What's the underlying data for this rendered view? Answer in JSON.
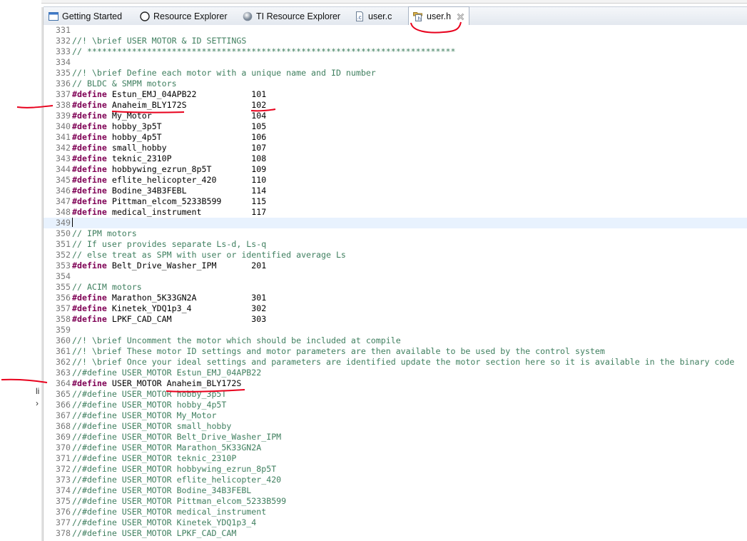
{
  "tabs": [
    {
      "label": "Getting Started",
      "icon": "window-icon",
      "active": false
    },
    {
      "label": "Resource Explorer",
      "icon": "compass-icon",
      "active": false
    },
    {
      "label": "TI Resource Explorer",
      "icon": "globe-icon",
      "active": false
    },
    {
      "label": "user.c",
      "icon": "c-file-icon",
      "active": false
    },
    {
      "label": "user.h",
      "icon": "h-file-icon",
      "active": true
    }
  ],
  "left_fragments": [
    "li",
    "›"
  ],
  "colors": {
    "keyword": "#7f0055",
    "comment": "#3f7f5f",
    "line_number": "#787878",
    "current_line": "#e8f2fe",
    "annotation": "#e8001c"
  },
  "current_line": 349,
  "lines": [
    {
      "n": "331",
      "k": "blank",
      "t": ""
    },
    {
      "n": "332",
      "k": "comment",
      "t": "//! \\brief USER MOTOR & ID SETTINGS"
    },
    {
      "n": "333",
      "k": "comment",
      "t": "// **************************************************************************"
    },
    {
      "n": "334",
      "k": "blank",
      "t": ""
    },
    {
      "n": "335",
      "k": "comment",
      "t": "//! \\brief Define each motor with a unique name and ID number"
    },
    {
      "n": "336",
      "k": "comment",
      "t": "// BLDC & SMPM motors"
    },
    {
      "n": "337",
      "k": "define",
      "t": " Estun_EMJ_04APB22           101"
    },
    {
      "n": "338",
      "k": "define",
      "t": " Anaheim_BLY172S             102"
    },
    {
      "n": "339",
      "k": "define",
      "t": " My_Motor                    104"
    },
    {
      "n": "340",
      "k": "define",
      "t": " hobby_3p5T                  105"
    },
    {
      "n": "341",
      "k": "define",
      "t": " hobby_4p5T                  106"
    },
    {
      "n": "342",
      "k": "define",
      "t": " small_hobby                 107"
    },
    {
      "n": "343",
      "k": "define",
      "t": " teknic_2310P                108"
    },
    {
      "n": "344",
      "k": "define",
      "t": " hobbywing_ezrun_8p5T        109"
    },
    {
      "n": "345",
      "k": "define",
      "t": " eflite_helicopter_420       110"
    },
    {
      "n": "346",
      "k": "define",
      "t": " Bodine_34B3FEBL             114"
    },
    {
      "n": "347",
      "k": "define",
      "t": " Pittman_elcom_5233B599      115"
    },
    {
      "n": "348",
      "k": "define",
      "t": " medical_instrument          117"
    },
    {
      "n": "349",
      "k": "blank",
      "t": ""
    },
    {
      "n": "350",
      "k": "comment",
      "t": "// IPM motors"
    },
    {
      "n": "351",
      "k": "comment",
      "t": "// If user provides separate Ls-d, Ls-q"
    },
    {
      "n": "352",
      "k": "comment",
      "t": "// else treat as SPM with user or identified average Ls"
    },
    {
      "n": "353",
      "k": "define",
      "t": " Belt_Drive_Washer_IPM       201"
    },
    {
      "n": "354",
      "k": "blank",
      "t": ""
    },
    {
      "n": "355",
      "k": "comment",
      "t": "// ACIM motors"
    },
    {
      "n": "356",
      "k": "define",
      "t": " Marathon_5K33GN2A           301"
    },
    {
      "n": "357",
      "k": "define",
      "t": " Kinetek_YDQ1p3_4            302"
    },
    {
      "n": "358",
      "k": "define",
      "t": " LPKF_CAD_CAM                303"
    },
    {
      "n": "359",
      "k": "blank",
      "t": ""
    },
    {
      "n": "360",
      "k": "comment",
      "t": "//! \\brief Uncomment the motor which should be included at compile"
    },
    {
      "n": "361",
      "k": "comment",
      "t": "//! \\brief These motor ID settings and motor parameters are then available to be used by the control system"
    },
    {
      "n": "362",
      "k": "comment",
      "t": "//! \\brief Once your ideal settings and parameters are identified update the motor section here so it is available in the binary code"
    },
    {
      "n": "363",
      "k": "comment",
      "t": "//#define USER_MOTOR Estun_EMJ_04APB22"
    },
    {
      "n": "364",
      "k": "define",
      "t": " USER_MOTOR Anaheim_BLY172S"
    },
    {
      "n": "365",
      "k": "comment",
      "t": "//#define USER_MOTOR hobby_3p5T"
    },
    {
      "n": "366",
      "k": "comment",
      "t": "//#define USER_MOTOR hobby_4p5T"
    },
    {
      "n": "367",
      "k": "comment",
      "t": "//#define USER_MOTOR My_Motor"
    },
    {
      "n": "368",
      "k": "comment",
      "t": "//#define USER_MOTOR small_hobby"
    },
    {
      "n": "369",
      "k": "comment",
      "t": "//#define USER_MOTOR Belt_Drive_Washer_IPM"
    },
    {
      "n": "370",
      "k": "comment",
      "t": "//#define USER_MOTOR Marathon_5K33GN2A"
    },
    {
      "n": "371",
      "k": "comment",
      "t": "//#define USER_MOTOR teknic_2310P"
    },
    {
      "n": "372",
      "k": "comment",
      "t": "//#define USER_MOTOR hobbywing_ezrun_8p5T"
    },
    {
      "n": "373",
      "k": "comment",
      "t": "//#define USER_MOTOR eflite_helicopter_420"
    },
    {
      "n": "374",
      "k": "comment",
      "t": "//#define USER_MOTOR Bodine_34B3FEBL"
    },
    {
      "n": "375",
      "k": "comment",
      "t": "//#define USER_MOTOR Pittman_elcom_5233B599"
    },
    {
      "n": "376",
      "k": "comment",
      "t": "//#define USER_MOTOR medical_instrument"
    },
    {
      "n": "377",
      "k": "comment",
      "t": "//#define USER_MOTOR Kinetek_YDQ1p3_4"
    },
    {
      "n": "378",
      "k": "comment",
      "t": "//#define USER_MOTOR LPKF_CAD_CAM"
    }
  ],
  "keyword": "#define"
}
